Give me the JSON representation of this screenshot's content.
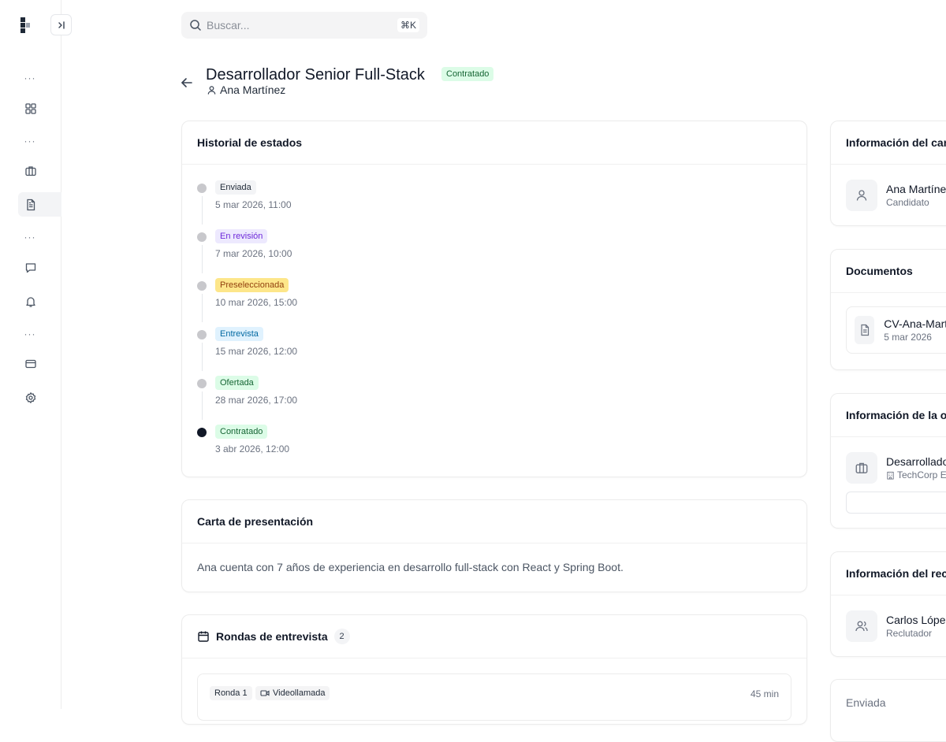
{
  "search": {
    "placeholder": "Buscar...",
    "shortcut": "⌘K"
  },
  "page": {
    "title": "Desarrollador Senior Full-Stack",
    "status_badge": "Contratado",
    "candidate_name": "Ana Martínez"
  },
  "colors": {
    "accent": "#111827",
    "success_bg": "#dcfce7",
    "success_text": "#166534"
  },
  "status_history": {
    "title": "Historial de estados",
    "items": [
      {
        "label": "Enviada",
        "date": "5 mar 2026, 11:00",
        "bg": "#f3f4f6",
        "fg": "#1f2937"
      },
      {
        "label": "En revisión",
        "date": "7 mar 2026, 10:00",
        "bg": "#ede9fe",
        "fg": "#6d28d9"
      },
      {
        "label": "Preseleccionada",
        "date": "10 mar 2026, 15:00",
        "bg": "#fde68a",
        "fg": "#92400e"
      },
      {
        "label": "Entrevista",
        "date": "15 mar 2026, 12:00",
        "bg": "#e0f2fe",
        "fg": "#0369a1"
      },
      {
        "label": "Ofertada",
        "date": "28 mar 2026, 17:00",
        "bg": "#dcfce7",
        "fg": "#166534"
      },
      {
        "label": "Contratado",
        "date": "3 abr 2026, 12:00",
        "bg": "#dcfce7",
        "fg": "#166534"
      }
    ]
  },
  "cover_letter": {
    "title": "Carta de presentación",
    "text": "Ana cuenta con 7 años de experiencia en desarrollo full-stack con React y Spring Boot."
  },
  "interview_rounds": {
    "title": "Rondas de entrevista",
    "count": "2",
    "rounds": [
      {
        "round": "Ronda 1",
        "type": "Videollamada",
        "duration": "45 min"
      }
    ]
  },
  "candidate_info": {
    "title": "Información del candidato",
    "name": "Ana Martínez",
    "role": "Candidato"
  },
  "documents": {
    "title": "Documentos",
    "file_name": "CV-Ana-Martínez.pdf",
    "file_date": "5 mar 2026"
  },
  "offer_info": {
    "title": "Información de la oferta",
    "position": "Desarrollador Senior Full-Stack",
    "company": "TechCorp España"
  },
  "recruiter_info": {
    "title": "Información del reclutador",
    "name": "Carlos López",
    "role": "Reclutador"
  },
  "application_status": {
    "label": "Enviada"
  },
  "sidebar": {
    "icons": [
      "grid-icon",
      "briefcase-icon",
      "file-text-icon",
      "message-icon",
      "bell-icon",
      "credit-card-icon",
      "settings-icon"
    ]
  }
}
